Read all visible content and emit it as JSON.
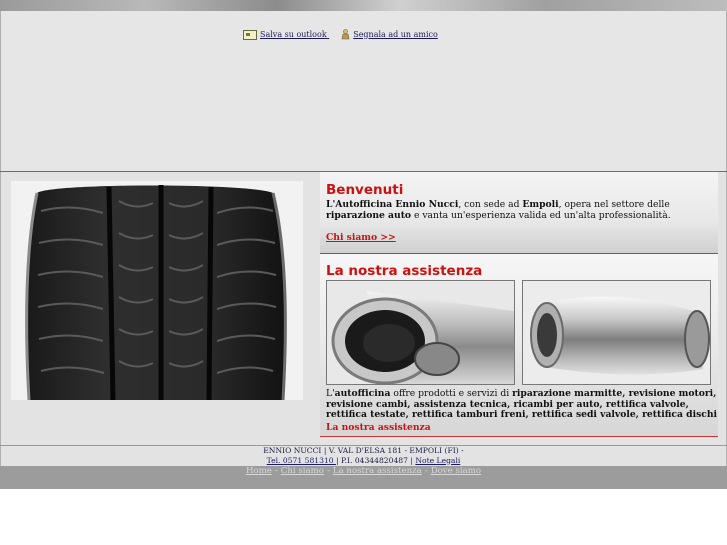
{
  "toolbar": {
    "save_outlook": "Salva su outlook",
    "signal_friend": "Segnala ad un amico",
    "save_icon": "outlook-calendar-icon",
    "friend_icon": "person-icon"
  },
  "welcome": {
    "title": "Benvenuti",
    "text_1": "L'Autofficina Ennio Nucci",
    "text_2": ", con sede ad ",
    "text_3": "Empoli",
    "text_4": ", opera nel settore delle ",
    "text_5": "riparazione auto",
    "text_6": " e vanta un'esperienza valida ed un'alta professionalità.",
    "link": "Chi siamo >>"
  },
  "assist": {
    "title": "La nostra assistenza",
    "text_1": "L'",
    "text_2": "autofficina",
    "text_3": " offre prodotti e servizi di ",
    "text_4": "riparazione marmitte, revisione motori, revisione cambi, assistenza tecnica, ricambi per auto, rettifica valvole, rettifica testate, rettifica tamburi freni, rettifica sedi valvole, rettifica dischi",
    "link": "La nostra assistenza"
  },
  "footer": {
    "line1": "ENNIO NUCCI | V. VAL D'ELSA 181 - EMPOLI (FI) -",
    "tel": "Tel. 0571 581310 ",
    "piva": "| P.I. 04344820487 |",
    "legal": "Note Legali"
  },
  "nav": {
    "home": "Home",
    "sep": "-",
    "chi_siamo": "Chi siamo",
    "assistenza": "La nostra assistenza",
    "dove_siamo": "Dove siamo"
  },
  "colors": {
    "accent": "#cc1111",
    "background": "#e3e3e3",
    "navbar": "#9c9c9c"
  }
}
